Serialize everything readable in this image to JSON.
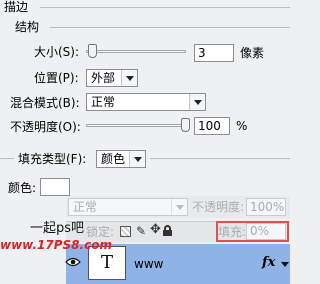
{
  "stroke": {
    "title": "描边",
    "structure_title": "结构",
    "size": {
      "label": "大小(S):",
      "value": "3",
      "unit": "像素",
      "level": 0.02
    },
    "position": {
      "label": "位置(P):",
      "value": "外部"
    },
    "blend_mode": {
      "label": "混合模式(B):",
      "value": "正常"
    },
    "opacity": {
      "label": "不透明度(O):",
      "value": "100",
      "unit": "%",
      "level": 1.0
    },
    "fill_type": {
      "label": "填充类型(F):",
      "value": "颜色"
    },
    "color": {
      "label": "颜色:",
      "swatch": "#ffffff"
    }
  },
  "layers_panel": {
    "blend_value": "正常",
    "opacity_label": "不透明度:",
    "opacity_value": "100%",
    "lock_label": "锁定:",
    "fill_label": "填充:",
    "fill_value": "0%",
    "layer": {
      "thumb_glyph": "T",
      "name": "www",
      "fx": "fx"
    }
  },
  "watermark": {
    "line1": "一起ps吧",
    "line2": "www.17PS8.com"
  },
  "colors": {
    "panel_bg": "#eef0f1",
    "selected_layer": "#8fb3e6",
    "highlight_box": "#e05050",
    "watermark_red": "#d8252a"
  }
}
